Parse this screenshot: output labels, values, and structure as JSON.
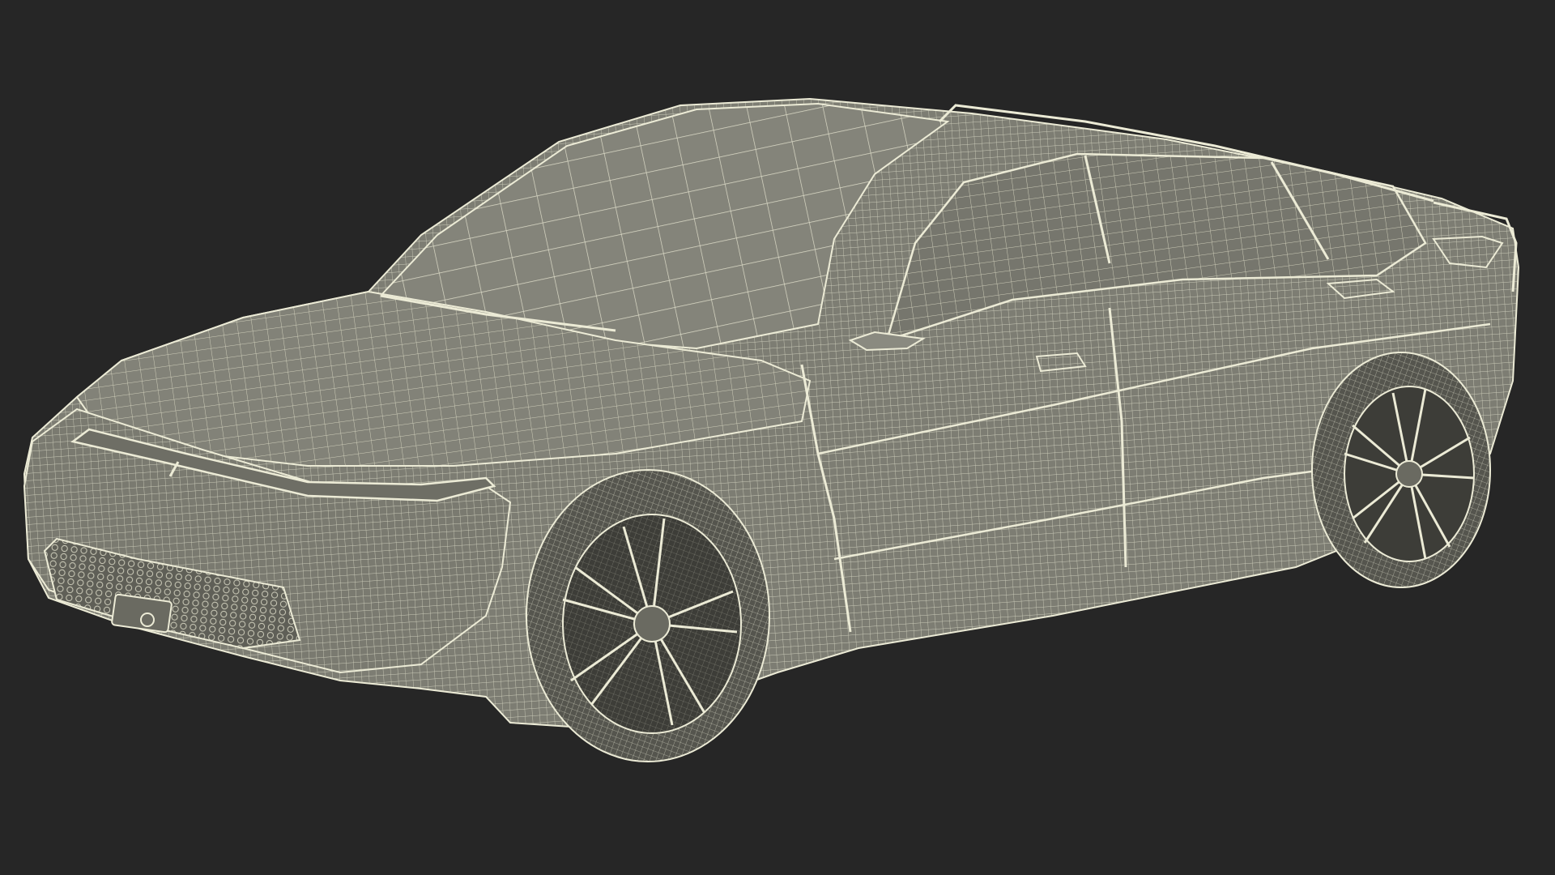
{
  "scene": {
    "subject": "wireframe-sedan",
    "colors": {
      "background": "#262626",
      "body_fill": "#7d7d73",
      "body_shade": "#6a6a61",
      "wire": "#ecebd6",
      "wheel_dark": "#3a3a36",
      "tire": "#55554e"
    }
  }
}
